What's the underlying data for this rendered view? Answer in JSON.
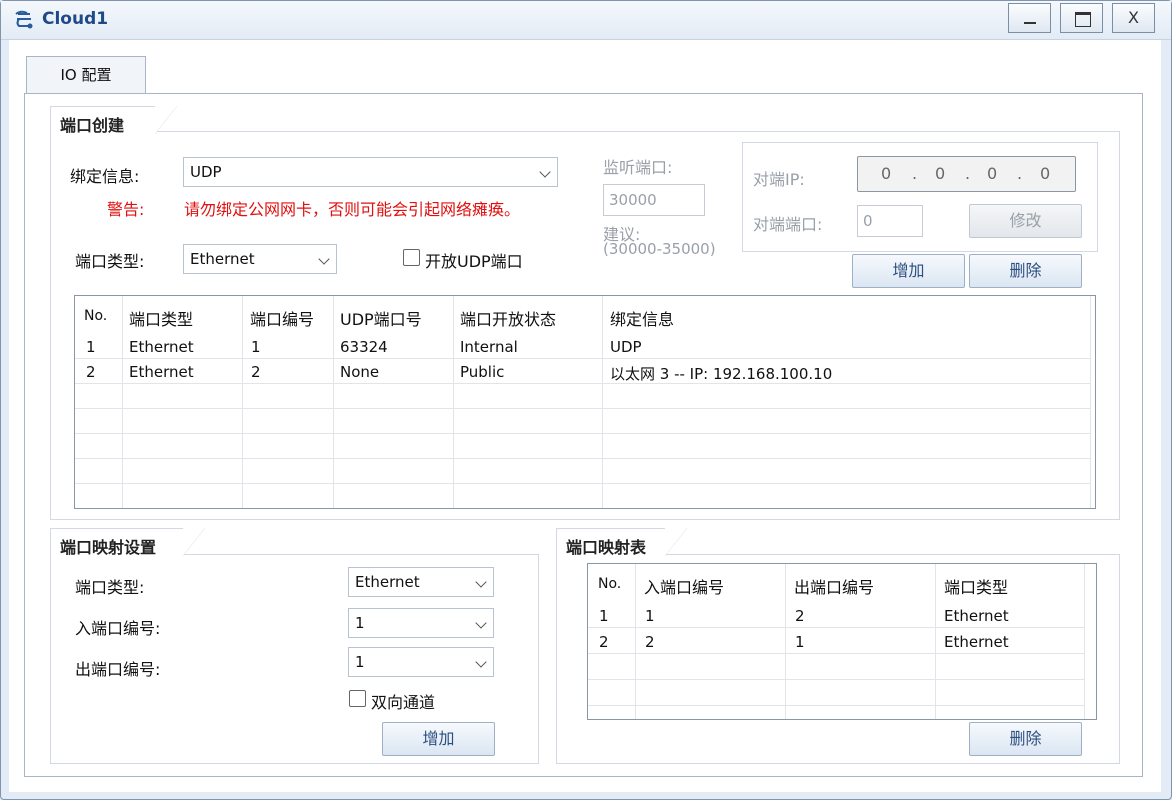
{
  "window": {
    "title": "Cloud1",
    "minimize_label": "_",
    "maximize_label": "□",
    "close_label": "X"
  },
  "tabs": [
    {
      "label": "IO 配置"
    }
  ],
  "port_creation": {
    "title": "端口创建",
    "bind_label": "绑定信息:",
    "bind_value": "UDP",
    "warning_label": "警告:",
    "warning_text": "请勿绑定公网网卡，否则可能会引起网络瘫痪。",
    "port_type_label": "端口类型:",
    "port_type_value": "Ethernet",
    "open_udp_label": "开放UDP端口",
    "open_udp_checked": false,
    "listen_port_label": "监听端口:",
    "listen_port_value": "30000",
    "suggest_label": "建议:",
    "suggest_range": "(30000-35000)",
    "peer_ip_label": "对端IP:",
    "peer_ip_octets": [
      "0",
      "0",
      "0",
      "0"
    ],
    "peer_port_label": "对端端口:",
    "peer_port_value": "0",
    "modify_button": "修改",
    "add_button": "增加",
    "delete_button": "删除",
    "columns": [
      "No.",
      "端口类型",
      "端口编号",
      "UDP端口号",
      "端口开放状态",
      "绑定信息"
    ],
    "rows": [
      [
        "1",
        "Ethernet",
        "1",
        "63324",
        "Internal",
        "UDP"
      ],
      [
        "2",
        "Ethernet",
        "2",
        "None",
        "Public",
        "以太网 3 -- IP: 192.168.100.10"
      ]
    ]
  },
  "mapping_settings": {
    "title": "端口映射设置",
    "port_type_label": "端口类型:",
    "port_type_value": "Ethernet",
    "in_port_label": "入端口编号:",
    "in_port_value": "1",
    "out_port_label": "出端口编号:",
    "out_port_value": "1",
    "bidirectional_label": "双向通道",
    "bidirectional_checked": false,
    "add_button": "增加"
  },
  "mapping_table": {
    "title": "端口映射表",
    "columns": [
      "No.",
      "入端口编号",
      "出端口编号",
      "端口类型"
    ],
    "rows": [
      [
        "1",
        "1",
        "2",
        "Ethernet"
      ],
      [
        "2",
        "2",
        "1",
        "Ethernet"
      ]
    ],
    "delete_button": "删除"
  }
}
